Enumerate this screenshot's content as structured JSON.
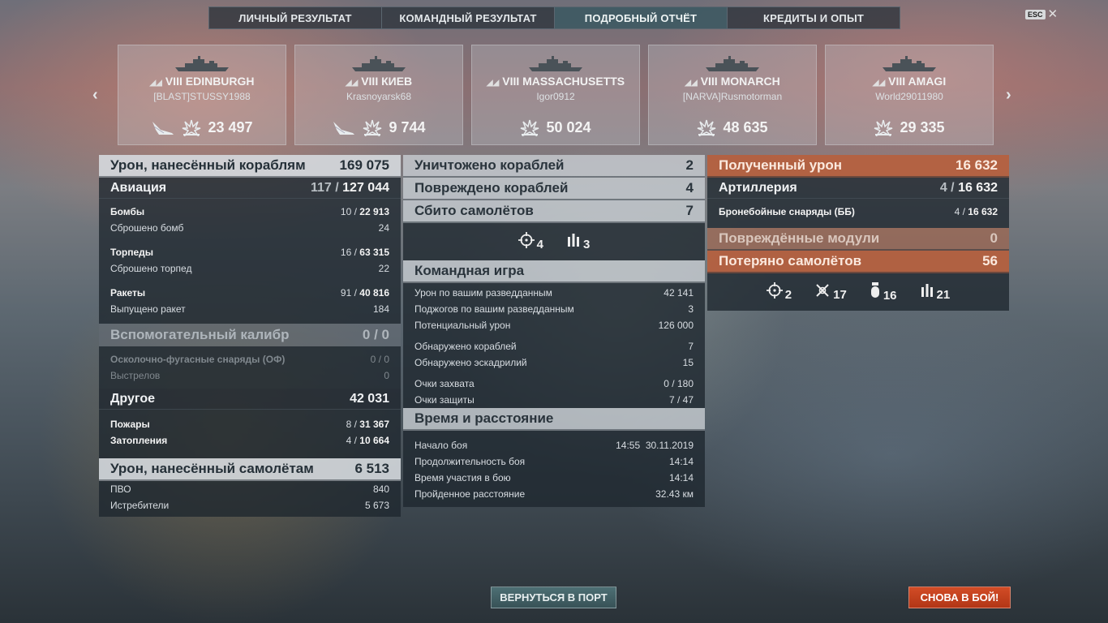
{
  "tabs": {
    "personal": "ЛИЧНЫЙ РЕЗУЛЬТАТ",
    "team": "КОМАНДНЫЙ РЕЗУЛЬТАТ",
    "detailed": "ПОДРОБНЫЙ ОТЧЁТ",
    "credits": "КРЕДИТЫ И ОПЫТ",
    "active": "detailed"
  },
  "esc": "ESC",
  "nav": {
    "prev": "‹",
    "next": "›"
  },
  "cards": [
    {
      "tier": "VIII",
      "name": "EDINBURGH",
      "player": "[BLAST]STUSSY1988",
      "damage": "23 497",
      "has_plane": true
    },
    {
      "tier": "VIII",
      "name": "КИЕВ",
      "player": "Krasnoyarsk68",
      "damage": "9 744",
      "has_plane": true
    },
    {
      "tier": "VIII",
      "name": "MASSACHUSETTS",
      "player": "Igor0912",
      "damage": "50 024",
      "has_plane": false
    },
    {
      "tier": "VIII",
      "name": "MONARCH",
      "player": "[NARVA]Rusmotorman",
      "damage": "48 635",
      "has_plane": false
    },
    {
      "tier": "VIII",
      "name": "AMAGI",
      "player": "World29011980",
      "damage": "29 335",
      "has_plane": false
    }
  ],
  "col1": {
    "ship_dmg": {
      "label": "Урон, нанесённый кораблям",
      "value": "169 075"
    },
    "aviation": {
      "label": "Авиация",
      "hits": "117",
      "sep": " / ",
      "value": "127 044"
    },
    "bombs": {
      "label": "Бомбы",
      "hits": "10",
      "value": "22 913"
    },
    "bombs_dropped": {
      "label": "Сброшено бомб",
      "value": "24"
    },
    "torps": {
      "label": "Торпеды",
      "hits": "16",
      "value": "63 315"
    },
    "torps_dropped": {
      "label": "Сброшено торпед",
      "value": "22"
    },
    "rockets": {
      "label": "Ракеты",
      "hits": "91",
      "value": "40 816"
    },
    "rockets_fired": {
      "label": "Выпущено ракет",
      "value": "184"
    },
    "secondary": {
      "label": "Вспомогательный калибр",
      "value": "0 / 0"
    },
    "he": {
      "label": "Осколочно-фугасные снаряды (ОФ)",
      "value": "0 / 0"
    },
    "shots": {
      "label": "Выстрелов",
      "value": "0"
    },
    "other": {
      "label": "Другое",
      "value": "42 031"
    },
    "fires": {
      "label": "Пожары",
      "hits": "8",
      "value": "31 367"
    },
    "floods": {
      "label": "Затопления",
      "hits": "4",
      "value": "10 664"
    },
    "plane_dmg": {
      "label": "Урон, нанесённый самолётам",
      "value": "6 513"
    },
    "aa": {
      "label": "ПВО",
      "value": "840"
    },
    "fighters": {
      "label": "Истребители",
      "value": "5 673"
    }
  },
  "col2": {
    "destroyed": {
      "label": "Уничтожено кораблей",
      "value": "2"
    },
    "damaged": {
      "label": "Повреждено кораблей",
      "value": "4"
    },
    "planes": {
      "label": "Сбито самолётов",
      "value": "7"
    },
    "icons": [
      {
        "name": "crosshair-icon",
        "value": "4"
      },
      {
        "name": "rocket-squadron-icon",
        "value": "3"
      }
    ],
    "team": {
      "label": "Командная игра"
    },
    "spot_dmg": {
      "label": "Урон по вашим разведданным",
      "value": "42 141"
    },
    "spot_fires": {
      "label": "Поджогов по вашим разведданным",
      "value": "3"
    },
    "potential": {
      "label": "Потенциальный урон",
      "value": "126 000"
    },
    "ships_spotted": {
      "label": "Обнаружено кораблей",
      "value": "7"
    },
    "sq_spotted": {
      "label": "Обнаружено эскадрилий",
      "value": "15"
    },
    "capture": {
      "label": "Очки захвата",
      "value": "0 / 180"
    },
    "defense": {
      "label": "Очки защиты",
      "value": "7 / 47"
    },
    "time": {
      "label": "Время и расстояние"
    },
    "start": {
      "label": "Начало боя",
      "value": "14:55  30.11.2019"
    },
    "duration": {
      "label": "Продолжительность боя",
      "value": "14:14"
    },
    "participation": {
      "label": "Время участия в бою",
      "value": "14:14"
    },
    "distance": {
      "label": "Пройденное расстояние",
      "value": "32.43 км"
    }
  },
  "col3": {
    "received": {
      "label": "Полученный урон",
      "value": "16 632"
    },
    "artillery": {
      "label": "Артиллерия",
      "hits": "4",
      "value": "16 632"
    },
    "ap": {
      "label": "Бронебойные снаряды (ББ)",
      "hits": "4",
      "value": "16 632"
    },
    "modules": {
      "label": "Повреждённые модули",
      "value": "0"
    },
    "planes_lost": {
      "label": "Потеряно самолётов",
      "value": "56"
    },
    "icons": [
      {
        "name": "crosshair-icon",
        "value": "2"
      },
      {
        "name": "fighter-icon",
        "value": "17"
      },
      {
        "name": "bomb-icon",
        "value": "16"
      },
      {
        "name": "rocket-squadron-icon",
        "value": "21"
      }
    ]
  },
  "buttons": {
    "port": "ВЕРНУТЬСЯ В ПОРТ",
    "battle": "СНОВА В БОЙ!"
  }
}
